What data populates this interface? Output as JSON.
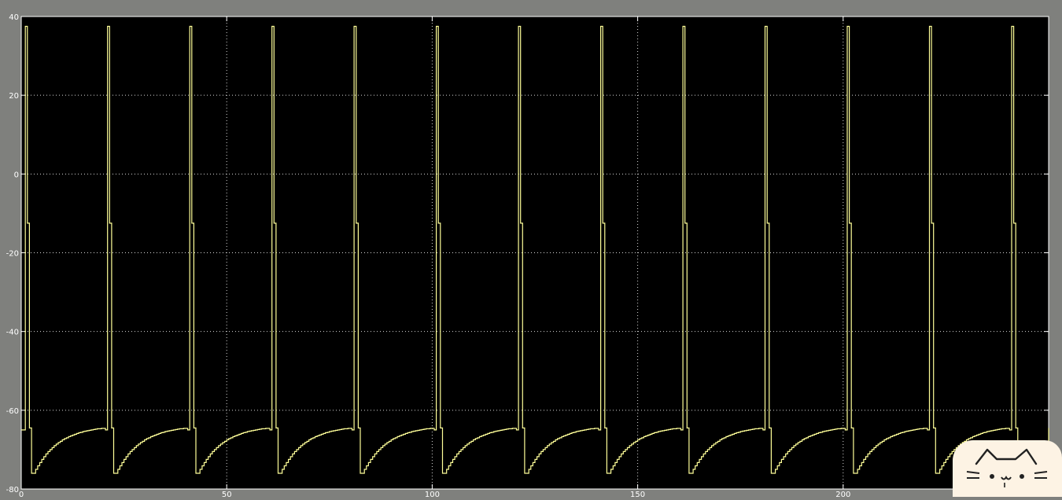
{
  "colors": {
    "frame": "#7f807d",
    "plot_background": "#000000",
    "trace": "#ffff99",
    "grid": "#ffffff",
    "badge": "#fdf3e4"
  },
  "icons": [
    "cat-face-icon"
  ],
  "chart_data": {
    "type": "line",
    "title": "",
    "xlabel": "",
    "ylabel": "",
    "xlim": [
      0,
      250
    ],
    "ylim": [
      -80,
      40
    ],
    "xticks": [
      0,
      50,
      100,
      150,
      200
    ],
    "yticks": [
      -80,
      -60,
      -40,
      -20,
      0,
      20,
      40
    ],
    "grid": true,
    "cycle": {
      "period": 20,
      "first_start": 0.5,
      "count": 13,
      "step": 0.5,
      "segments": [
        {
          "dt": 0.0,
          "y": -65
        },
        {
          "dt": 0.5,
          "y": 37.5
        },
        {
          "dt": 1.0,
          "y": -12.5
        },
        {
          "dt": 1.5,
          "y": -64.5
        },
        {
          "dt": 2.0,
          "y": -76
        }
      ],
      "recovery": {
        "from": -76,
        "to": -64.5,
        "start_dt": 2.5,
        "end_dt": 20,
        "shape": "saturating"
      }
    },
    "series": [
      {
        "values_note": "",
        "x": [
          0,
          0.5,
          1.0,
          1.5,
          2.0,
          2.5,
          20.5
        ],
        "y": [
          -65,
          37.5,
          -12.5,
          -64.5,
          -76,
          -75.3,
          -64.5
        ]
      }
    ]
  }
}
